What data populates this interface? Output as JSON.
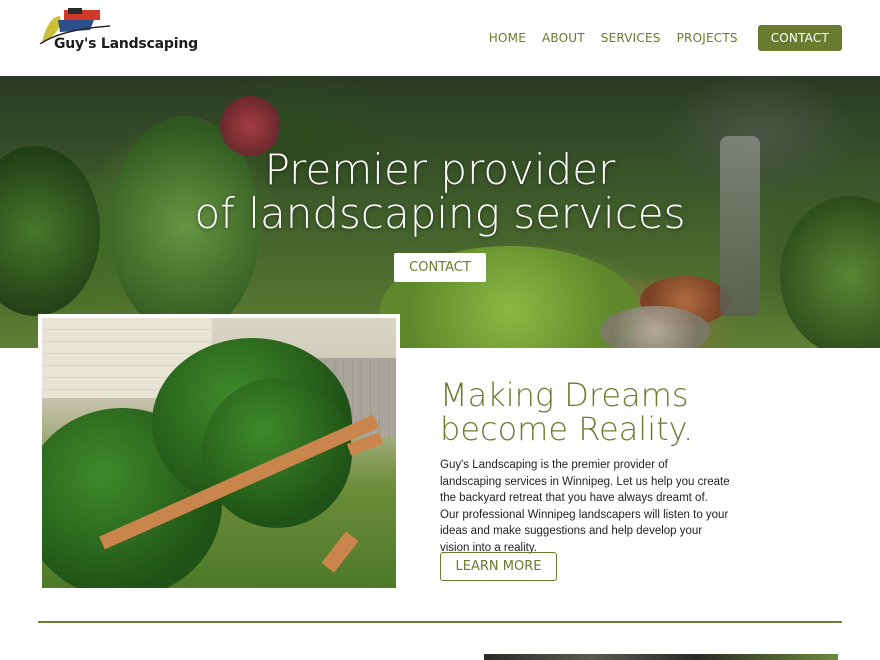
{
  "brand": {
    "name": "Guy's Landscaping",
    "accent_color": "#6a7a2e",
    "logo_colors": [
      "#c9c03a",
      "#d03a2a",
      "#2a4f8a",
      "#2a2a2a"
    ]
  },
  "nav": {
    "items": [
      {
        "label": "HOME"
      },
      {
        "label": "ABOUT"
      },
      {
        "label": "SERVICES"
      },
      {
        "label": "PROJECTS"
      }
    ],
    "contact_label": "CONTACT"
  },
  "hero": {
    "title_line1": "Premier provider",
    "title_line2": "of landscaping services",
    "cta_label": "CONTACT"
  },
  "feature": {
    "title_line1": "Making Dreams",
    "title_line2": "become Reality.",
    "body": "Guy's Landscaping is the premier provider of landscaping services in Winnipeg. Let us help you create the backyard retreat that you have always dreamt of. Our professional Winnipeg landscapers will listen to your ideas and make suggestions and help develop your vision into a reality.",
    "cta_label": "LEARN MORE"
  }
}
